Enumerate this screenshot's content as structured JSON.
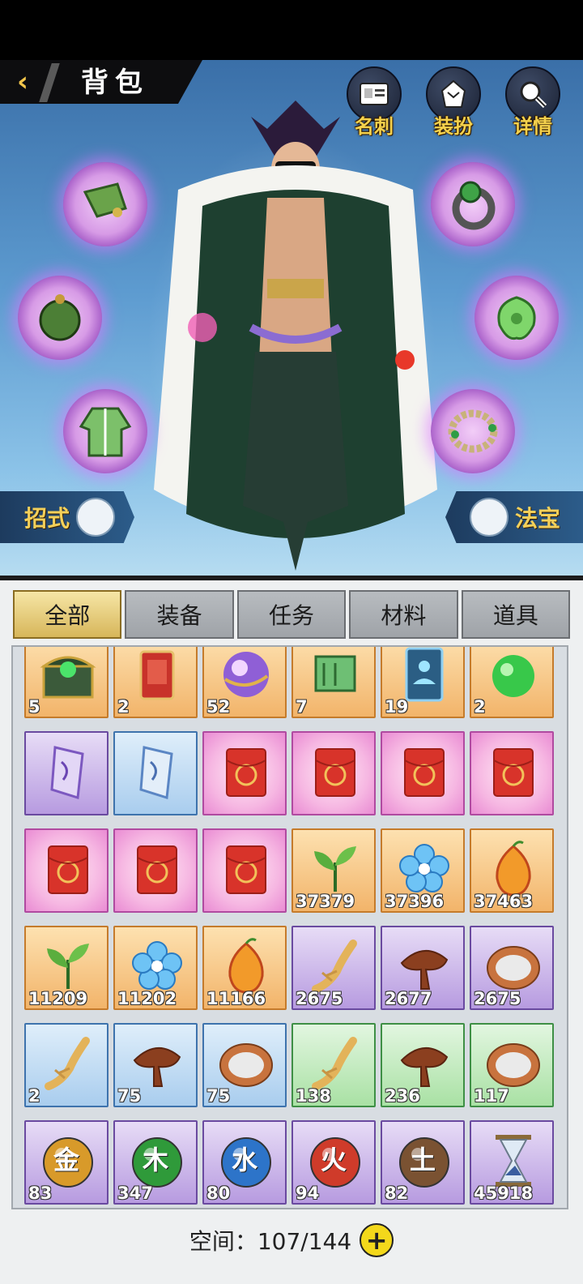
{
  "header": {
    "title": "背包"
  },
  "top_buttons": [
    {
      "label": "名刺",
      "icon": "card-icon"
    },
    {
      "label": "装扮",
      "icon": "costume-icon"
    },
    {
      "label": "详情",
      "icon": "magnifier-icon"
    }
  ],
  "equip_slots": [
    {
      "icon": "headband-icon"
    },
    {
      "icon": "orb-pendant-icon"
    },
    {
      "icon": "robe-icon"
    },
    {
      "icon": "ring-icon"
    },
    {
      "icon": "jade-amulet-icon"
    },
    {
      "icon": "bracelet-icon"
    }
  ],
  "side_buttons": {
    "left": "招式",
    "right": "法宝"
  },
  "tabs": [
    "全部",
    "装备",
    "任务",
    "材料",
    "道具"
  ],
  "active_tab": "全部",
  "items": [
    {
      "name": "treasure-chest",
      "count": "5",
      "rarity": "orange"
    },
    {
      "name": "wish-charm",
      "count": "2",
      "rarity": "orange"
    },
    {
      "name": "cosmic-orb",
      "count": "52",
      "rarity": "orange"
    },
    {
      "name": "jade-scroll",
      "count": "7",
      "rarity": "orange"
    },
    {
      "name": "meditation-card",
      "count": "19",
      "rarity": "orange"
    },
    {
      "name": "green-sphere",
      "count": "2",
      "rarity": "orange"
    },
    {
      "name": "purple-talisman",
      "count": "",
      "rarity": "purple"
    },
    {
      "name": "blue-talisman",
      "count": "",
      "rarity": "blue"
    },
    {
      "name": "red-envelope",
      "count": "",
      "rarity": "pink"
    },
    {
      "name": "red-envelope",
      "count": "",
      "rarity": "pink"
    },
    {
      "name": "red-envelope",
      "count": "",
      "rarity": "pink"
    },
    {
      "name": "red-envelope",
      "count": "",
      "rarity": "pink"
    },
    {
      "name": "red-envelope",
      "count": "",
      "rarity": "pink"
    },
    {
      "name": "red-envelope",
      "count": "",
      "rarity": "pink"
    },
    {
      "name": "red-envelope",
      "count": "",
      "rarity": "pink"
    },
    {
      "name": "tea-leaf",
      "count": "37379",
      "rarity": "orange"
    },
    {
      "name": "ice-flower",
      "count": "37396",
      "rarity": "orange"
    },
    {
      "name": "fire-fruit",
      "count": "37463",
      "rarity": "orange"
    },
    {
      "name": "tea-leaf",
      "count": "11209",
      "rarity": "orange"
    },
    {
      "name": "ice-flower",
      "count": "11202",
      "rarity": "orange"
    },
    {
      "name": "fire-fruit",
      "count": "11166",
      "rarity": "orange"
    },
    {
      "name": "ginseng",
      "count": "2675",
      "rarity": "purple"
    },
    {
      "name": "lingzhi",
      "count": "2677",
      "rarity": "purple"
    },
    {
      "name": "rice-bowl",
      "count": "2675",
      "rarity": "purple"
    },
    {
      "name": "ginseng",
      "count": "2",
      "rarity": "blue"
    },
    {
      "name": "lingzhi",
      "count": "75",
      "rarity": "blue"
    },
    {
      "name": "rice-bowl",
      "count": "75",
      "rarity": "blue"
    },
    {
      "name": "ginseng",
      "count": "138",
      "rarity": "green"
    },
    {
      "name": "lingzhi",
      "count": "236",
      "rarity": "green"
    },
    {
      "name": "rice-bowl",
      "count": "117",
      "rarity": "green"
    },
    {
      "name": "gold-element",
      "glyph": "金",
      "count": "83",
      "rarity": "purple",
      "color": "#d89a2a"
    },
    {
      "name": "wood-element",
      "glyph": "木",
      "count": "347",
      "rarity": "purple",
      "color": "#2f9a3a"
    },
    {
      "name": "water-element",
      "glyph": "水",
      "count": "80",
      "rarity": "purple",
      "color": "#2d74c9"
    },
    {
      "name": "fire-element",
      "glyph": "火",
      "count": "94",
      "rarity": "purple",
      "color": "#cf3b2a"
    },
    {
      "name": "earth-element",
      "glyph": "土",
      "count": "82",
      "rarity": "purple",
      "color": "#7a5232"
    },
    {
      "name": "hourglass",
      "count": "45918",
      "rarity": "purple"
    }
  ],
  "footer": {
    "label": "空间：107/144"
  }
}
